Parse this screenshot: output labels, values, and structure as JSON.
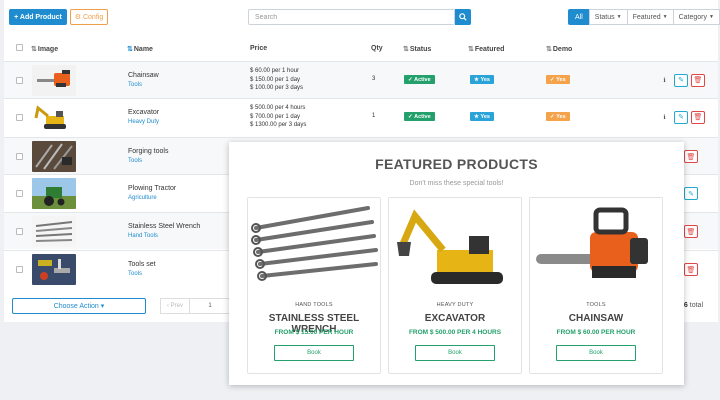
{
  "toolbar": {
    "add_label": "+ Add Product",
    "config_label": "⚙ Config",
    "search_placeholder": "Search",
    "filters": [
      "All",
      "Status",
      "Featured",
      "Category"
    ]
  },
  "columns": [
    "Image",
    "Name",
    "Price",
    "Qty",
    "Status",
    "Featured",
    "Demo"
  ],
  "rows": [
    {
      "name": "Chainsaw",
      "category": "Tools",
      "price_lines": [
        "$ 60.00 per 1 hour",
        "$ 150.00 per 1 day",
        "$ 100.00 per 3 days"
      ],
      "qty": "3",
      "status": "Active",
      "featured": "Yes",
      "demo": "Yes"
    },
    {
      "name": "Excavator",
      "category": "Heavy Duty",
      "price_lines": [
        "$ 500.00 per 4 hours",
        "$ 700.00 per 1 day",
        "$ 1300.00 per 3 days"
      ],
      "qty": "1",
      "status": "Active",
      "featured": "Yes",
      "demo": "Yes"
    },
    {
      "name": "Forging tools",
      "category": "Tools"
    },
    {
      "name": "Plowing Tractor",
      "category": "Agriculture"
    },
    {
      "name": "Stainless Steel Wrench",
      "category": "Hand Tools"
    },
    {
      "name": "Tools set",
      "category": "Tools"
    }
  ],
  "footer": {
    "choose_action": "Choose Action ▾",
    "prev_label": "‹ Prev",
    "page_num": "1",
    "total_prefix": "f",
    "total_count": "6",
    "total_suffix": "total"
  },
  "featured": {
    "title": "FEATURED PRODUCTS",
    "subtitle": "Don't miss these special tools!",
    "cards": [
      {
        "category": "HAND TOOLS",
        "name": "STAINLESS STEEL WRENCH",
        "price": "FROM $ 15.00 PER HOUR",
        "button": "Book"
      },
      {
        "category": "HEAVY DUTY",
        "name": "EXCAVATOR",
        "price": "FROM $ 500.00 PER 4 HOURS",
        "button": "Book"
      },
      {
        "category": "TOOLS",
        "name": "CHAINSAW",
        "price": "FROM $ 60.00 PER HOUR",
        "button": "Book"
      }
    ]
  },
  "colors": {
    "primary": "#1f8ccf",
    "active": "#23a06b",
    "featured": "#2aa3d8",
    "demo": "#f4a34a",
    "danger": "#e04848"
  }
}
